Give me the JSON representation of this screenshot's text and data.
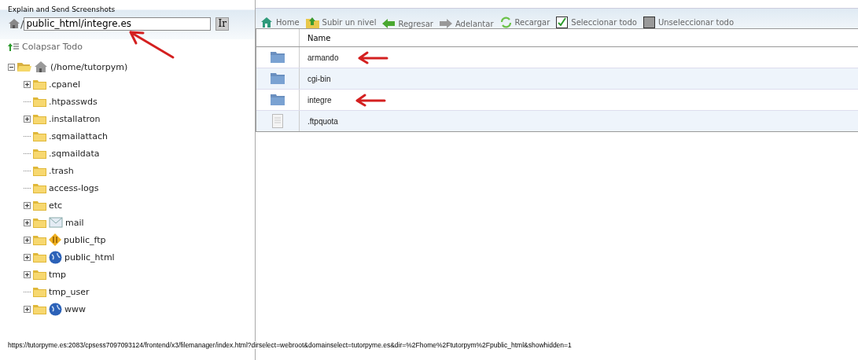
{
  "header": {
    "link": "Explain and Send Screenshots"
  },
  "path_bar": {
    "separator": "/",
    "value": "public_html/integre.es",
    "go_button": "Ir",
    "arrow": true
  },
  "collapse_all": "Colapsar Todo",
  "tree": {
    "label": "(/home/tutorpym)",
    "expanded": true,
    "children": [
      {
        "label": ".cpanel",
        "expandable": true,
        "kind": "plain"
      },
      {
        "label": ".htpasswds",
        "expandable": false,
        "kind": "plain"
      },
      {
        "label": ".installatron",
        "expandable": true,
        "kind": "plain"
      },
      {
        "label": ".sqmailattach",
        "expandable": false,
        "kind": "plain"
      },
      {
        "label": ".sqmaildata",
        "expandable": false,
        "kind": "plain"
      },
      {
        "label": ".trash",
        "expandable": false,
        "kind": "plain"
      },
      {
        "label": "access-logs",
        "expandable": false,
        "kind": "plain"
      },
      {
        "label": "etc",
        "expandable": true,
        "kind": "plain"
      },
      {
        "label": "mail",
        "expandable": true,
        "kind": "mail"
      },
      {
        "label": "public_ftp",
        "expandable": true,
        "kind": "ftp"
      },
      {
        "label": "public_html",
        "expandable": true,
        "kind": "globe"
      },
      {
        "label": "tmp",
        "expandable": true,
        "kind": "plain"
      },
      {
        "label": "tmp_user",
        "expandable": false,
        "kind": "plain"
      },
      {
        "label": "www",
        "expandable": true,
        "kind": "globe"
      }
    ]
  },
  "toolbar": [
    {
      "label": "Home",
      "kind": "home"
    },
    {
      "label": "Subir un nivel",
      "kind": "up"
    },
    {
      "label": "Regresar",
      "kind": "back"
    },
    {
      "label": "Adelantar",
      "kind": "forward"
    },
    {
      "label": "Recargar",
      "kind": "reload"
    },
    {
      "label": "Seleccionar todo",
      "kind": "check"
    },
    {
      "label": "Unseleccionar todo",
      "kind": "uncheck"
    }
  ],
  "table": {
    "columns": [
      "Name"
    ],
    "rows": [
      {
        "name": "armando",
        "kind": "folder",
        "arrow": true
      },
      {
        "name": "cgi-bin",
        "kind": "folder",
        "arrow": false
      },
      {
        "name": "integre",
        "kind": "folder",
        "arrow": true
      },
      {
        "name": ".ftpquota",
        "kind": "file",
        "arrow": false
      }
    ]
  },
  "status_bar": "https://tutorpyme.es:2083/cpsess7097093124/frontend/x3/filemanager/index.html?dirselect=webroot&domainselect=tutorpyme.es&dir=%2Fhome%2Ftutorpym%2Fpublic_html&showhidden=1"
}
